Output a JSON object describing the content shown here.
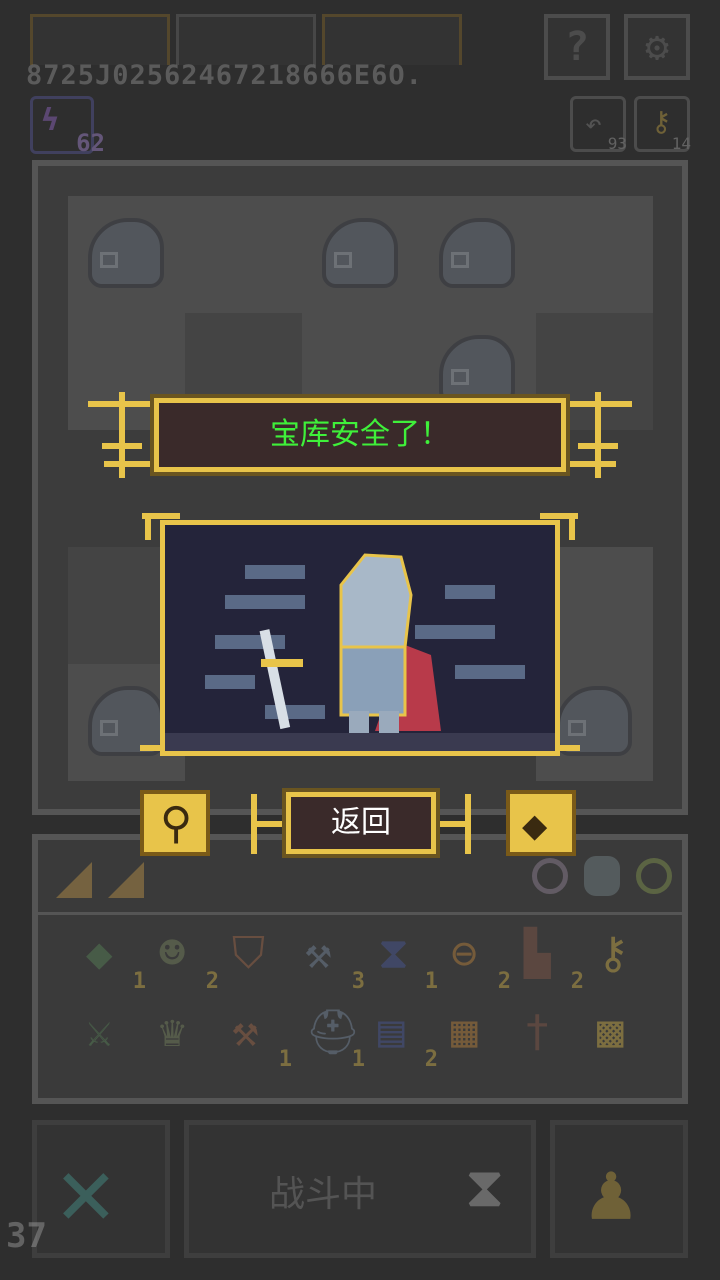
{
  "seed_text": "8725J02562467218666E6O.",
  "energy": {
    "icon": "lightning-icon",
    "value": "62"
  },
  "counters": {
    "undo": "93",
    "keys": "14"
  },
  "top_buttons": {
    "help": "?",
    "settings": "gear-icon"
  },
  "dialog": {
    "title": "宝库安全了！",
    "back_label": "返回",
    "title_color": "#3ff03a"
  },
  "inventory": {
    "row1": [
      {
        "icon": "emerald-gem-icon",
        "count": "1"
      },
      {
        "icon": "goblin-icon",
        "count": "2"
      },
      {
        "icon": "shield-icon",
        "count": ""
      },
      {
        "icon": "axe-icon",
        "count": "3"
      },
      {
        "icon": "hourglass-icon",
        "count": "1"
      },
      {
        "icon": "ring-icon",
        "count": "2"
      },
      {
        "icon": "boot-icon",
        "count": "2"
      },
      {
        "icon": "key-icon",
        "count": ""
      }
    ],
    "row2": [
      {
        "icon": "sword-icon",
        "count": ""
      },
      {
        "icon": "crown-icon",
        "count": ""
      },
      {
        "icon": "battle-axe-icon",
        "count": "1"
      },
      {
        "icon": "helmet-icon",
        "count": "1"
      },
      {
        "icon": "scroll-icon",
        "count": "2"
      },
      {
        "icon": "map-icon",
        "count": ""
      },
      {
        "icon": "dagger-icon",
        "count": ""
      },
      {
        "icon": "rune-icon",
        "count": ""
      }
    ]
  },
  "bottom": {
    "status_label": "战斗中",
    "turn_counter": "37"
  },
  "colors": {
    "accent_gold": "#e8c44a",
    "banner_bg": "#3a2a2a"
  }
}
